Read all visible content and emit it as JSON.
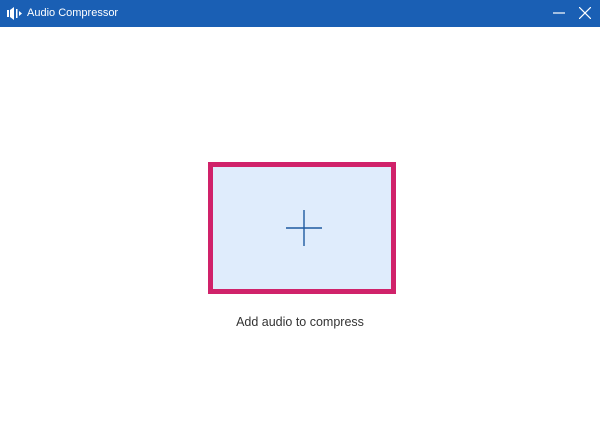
{
  "window": {
    "title": "Audio Compressor",
    "app_icon": "audio-compress-icon",
    "controls": [
      "minimize-icon",
      "close-icon"
    ]
  },
  "main": {
    "drop_zone_icon": "plus-icon",
    "caption": "Add audio to compress"
  },
  "colors": {
    "titlebar": "#1a5fb4",
    "drop_zone_border": "#d0226a",
    "drop_zone_fill": "#dfecfc",
    "plus": "#1f5aa0"
  }
}
